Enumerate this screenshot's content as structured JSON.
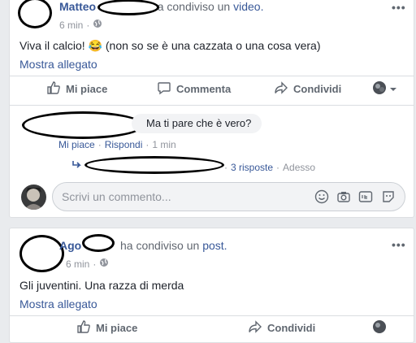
{
  "post1": {
    "author": "Matteo",
    "action_text": "ha condiviso un",
    "object_link": "video.",
    "time": "6 min",
    "text": "Viva il calcio! 😂 (non so se è una cazzata o una cosa vera)",
    "show_attachment": "Mostra allegato",
    "actions": {
      "like": "Mi piace",
      "comment": "Commenta",
      "share": "Condividi"
    },
    "comment": {
      "text": "Ma ti pare che è vero?",
      "like": "Mi piace",
      "reply": "Rispondi",
      "time": "1 min"
    },
    "replies": {
      "text": "3 risposte",
      "time": "Adesso"
    },
    "comment_placeholder": "Scrivi un commento..."
  },
  "post2": {
    "author": "Ago",
    "action_text": "ha condiviso un",
    "object_link": "post.",
    "time": "6 min",
    "text": "Gli juventini. Una razza di merda",
    "show_attachment": "Mostra allegato",
    "actions": {
      "like": "Mi piace",
      "share": "Condividi"
    }
  },
  "colors": {
    "link": "#385898",
    "background": "#e9ebee",
    "muted": "#90949c"
  }
}
